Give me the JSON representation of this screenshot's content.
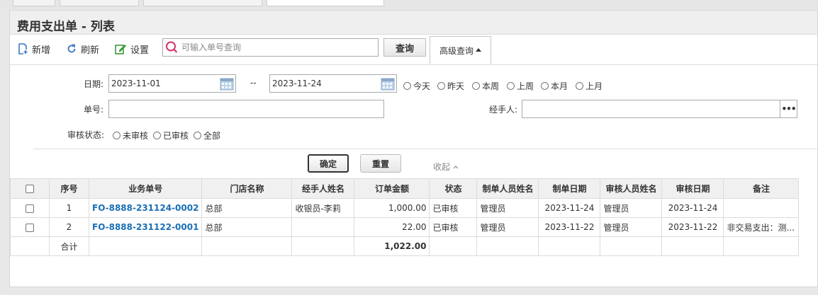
{
  "page": {
    "title": "费用支出单 - 列表"
  },
  "toolbar": {
    "add_label": "新增",
    "refresh_label": "刷新",
    "settings_label": "设置",
    "search_placeholder": "可输入单号查询",
    "query_label": "查询",
    "advanced_label": "高级查询"
  },
  "filters": {
    "date_label": "日期:",
    "date_from": "2023-11-01",
    "date_sep": "--",
    "date_to": "2023-11-24",
    "date_presets": [
      "今天",
      "昨天",
      "本周",
      "上周",
      "本月",
      "上月"
    ],
    "order_no_label": "单号:",
    "handler_label": "经手人:",
    "audit_label": "审核状态:",
    "audit_options": [
      "未审核",
      "已审核",
      "全部"
    ],
    "ok_label": "确定",
    "reset_label": "重置",
    "collapse_label": "收起"
  },
  "table": {
    "columns": [
      "序号",
      "业务单号",
      "门店名称",
      "经手人姓名",
      "订单金额",
      "状态",
      "制单人员姓名",
      "制单日期",
      "审核人员姓名",
      "审核日期",
      "备注"
    ],
    "rows": [
      {
        "seq": "1",
        "order_no": "FO-8888-231124-0002",
        "store": "总部",
        "handler": "收银员-李莉",
        "amount": "1,000.00",
        "status": "已审核",
        "creator": "管理员",
        "created": "2023-11-24",
        "auditor": "管理员",
        "audited": "2023-11-24",
        "remark": ""
      },
      {
        "seq": "2",
        "order_no": "FO-8888-231122-0001",
        "store": "总部",
        "handler": "",
        "amount": "22.00",
        "status": "已审核",
        "creator": "管理员",
        "created": "2023-11-22",
        "auditor": "管理员",
        "audited": "2023-11-22",
        "remark": "非交易支出：测..."
      }
    ],
    "summary": {
      "label": "合计",
      "amount": "1,022.00"
    }
  },
  "colors": {
    "link": "#1a6fb5",
    "search_icon": "#d6336c",
    "accent_blue": "#3a78c3",
    "settings_green": "#3a9a3a"
  }
}
